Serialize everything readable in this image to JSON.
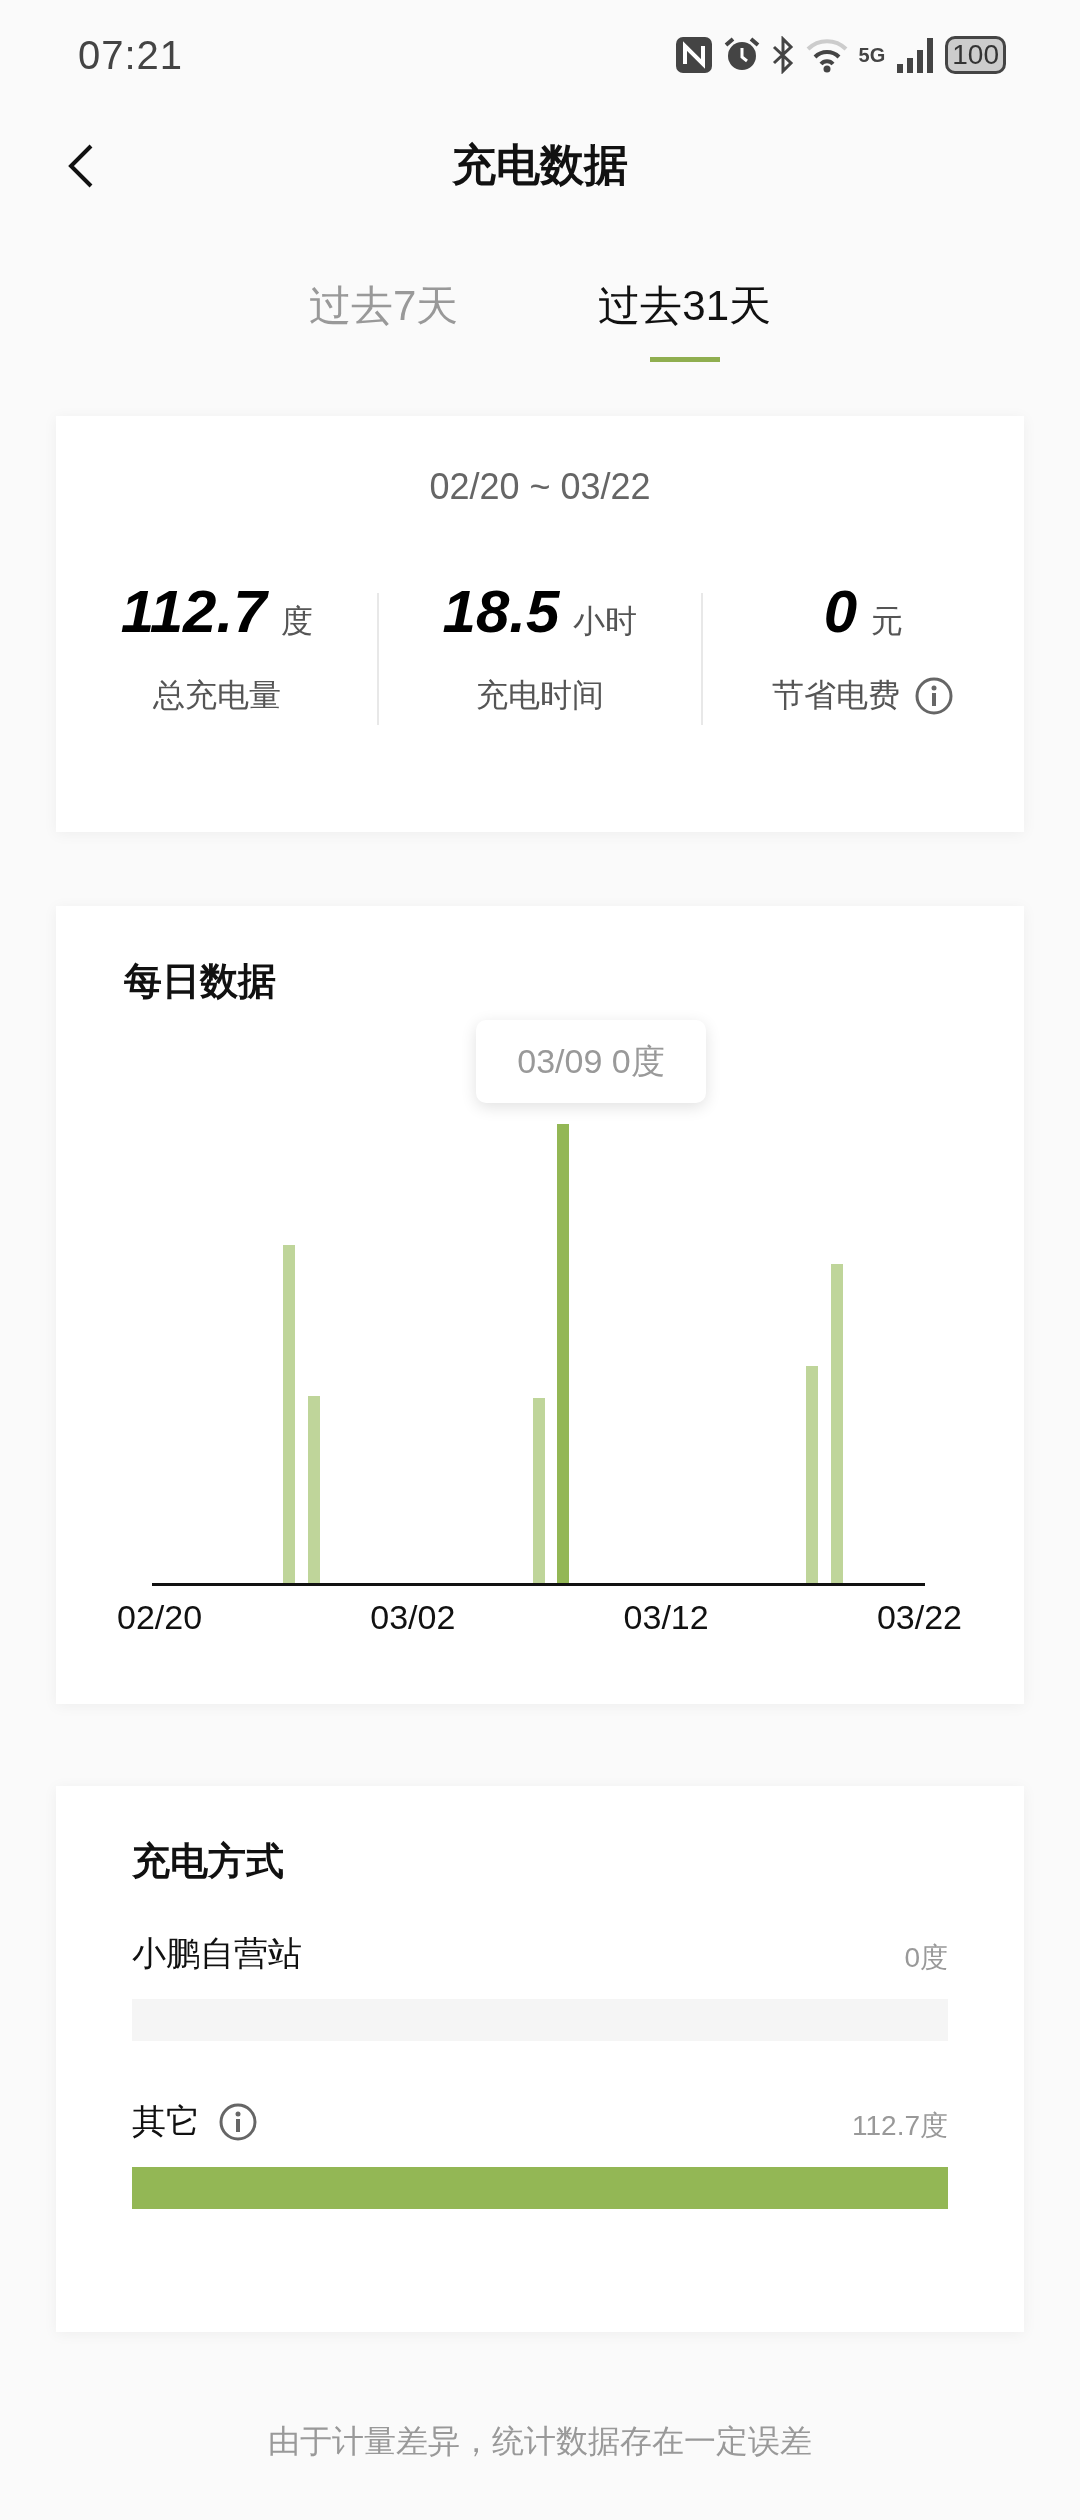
{
  "status_bar": {
    "time": "07:21",
    "network": "5G",
    "battery": "100"
  },
  "header": {
    "title": "充电数据"
  },
  "tabs": [
    {
      "label": "过去7天",
      "selected": false
    },
    {
      "label": "过去31天",
      "selected": true
    }
  ],
  "summary": {
    "date_range": "02/20 ~ 03/22",
    "stats": [
      {
        "value": "112.7",
        "unit": "度",
        "label": "总充电量",
        "info": false
      },
      {
        "value": "18.5",
        "unit": "小时",
        "label": "充电时间",
        "info": false
      },
      {
        "value": "0",
        "unit": "元",
        "label": "节省电费",
        "info": true
      }
    ]
  },
  "daily": {
    "title": "每日数据",
    "tooltip": "03/09 0度",
    "x_labels": [
      "02/20",
      "03/02",
      "03/12",
      "03/22"
    ]
  },
  "methods": {
    "title": "充电方式",
    "items": [
      {
        "name": "小鹏自营站",
        "info": false,
        "reading": "0度"
      },
      {
        "name": "其它",
        "info": true,
        "reading": "112.7度",
        "level": 1
      }
    ]
  },
  "footer": "由于计量差异，统计数据存在一定误差"
}
